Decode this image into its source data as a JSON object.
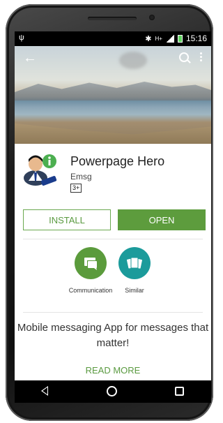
{
  "status_bar": {
    "time": "15:16",
    "network": "H+",
    "icons": [
      "usb-icon",
      "bluetooth-icon",
      "signal-icon",
      "battery-icon"
    ]
  },
  "app_bar": {
    "icons": [
      "back-arrow-icon",
      "search-icon",
      "more-vert-icon"
    ]
  },
  "app": {
    "title": "Powerpage Hero",
    "developer": "Emsg",
    "rating": "3+"
  },
  "actions": {
    "install_label": "INSTALL",
    "open_label": "OPEN"
  },
  "categories": [
    {
      "label": "Communication",
      "icon": "chat-icon",
      "color": "#5b9b3c"
    },
    {
      "label": "Similar",
      "icon": "cards-icon",
      "color": "#1b9b9b"
    }
  ],
  "description": {
    "text": "Mobile messaging App for messages that matter!",
    "read_more": "READ MORE"
  },
  "colors": {
    "accent": "#5d9c3d",
    "teal": "#1b9b9b"
  }
}
